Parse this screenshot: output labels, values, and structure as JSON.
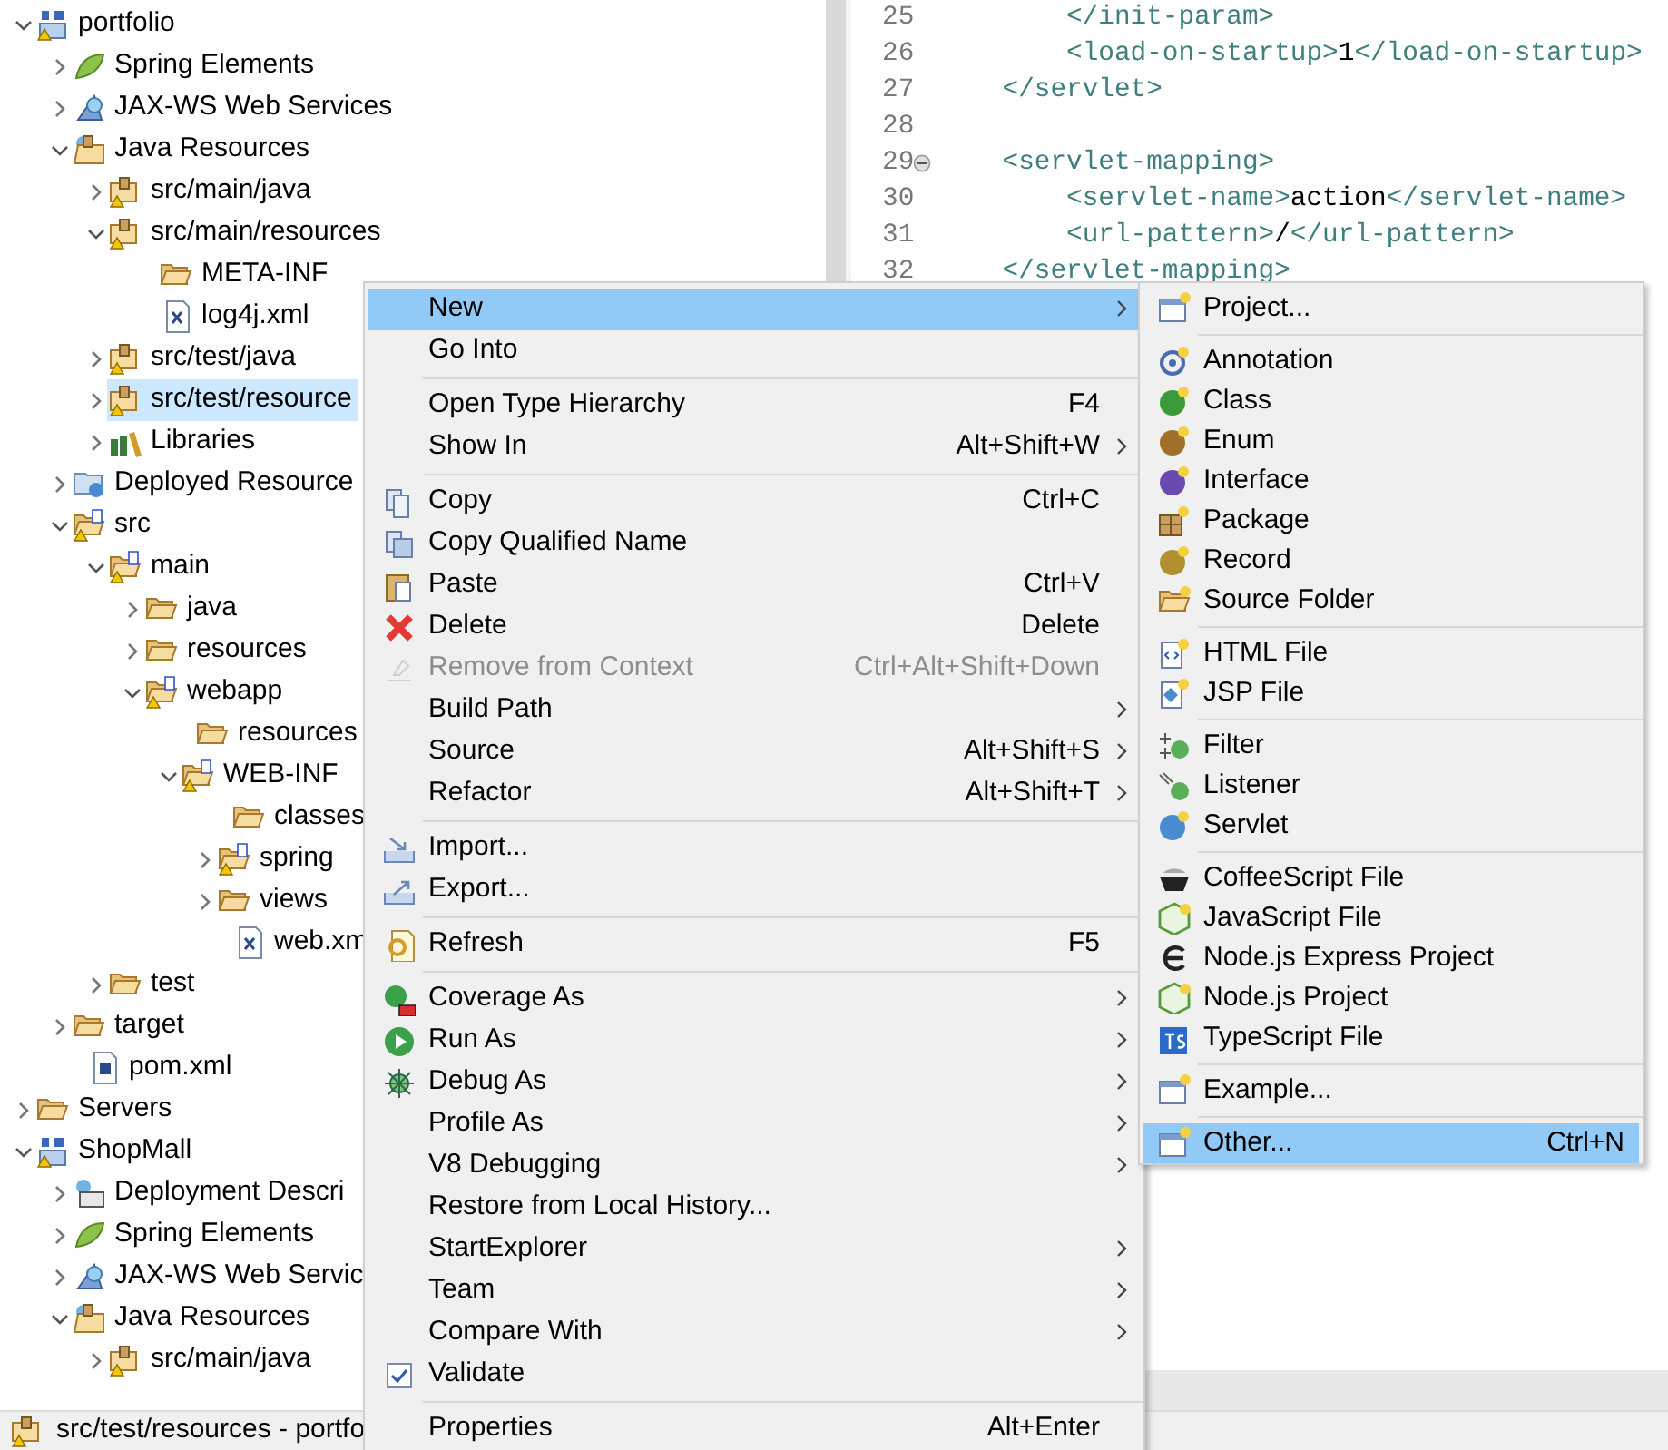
{
  "tree": [
    {
      "label": "portfolio",
      "kind": "project",
      "selected": false,
      "expanded": true,
      "children": [
        {
          "label": "Spring Elements",
          "kind": "spring",
          "selected": false,
          "expanded": false
        },
        {
          "label": "JAX-WS Web Services",
          "kind": "webservice",
          "selected": false,
          "expanded": false
        },
        {
          "label": "Java Resources",
          "kind": "javares",
          "selected": false,
          "expanded": true,
          "children": [
            {
              "label": "src/main/java",
              "kind": "package",
              "selected": false,
              "expanded": false
            },
            {
              "label": "src/main/resources",
              "kind": "package",
              "selected": false,
              "expanded": true,
              "children": [
                {
                  "label": "META-INF",
                  "kind": "folder",
                  "selected": false
                },
                {
                  "label": "log4j.xml",
                  "kind": "xml",
                  "selected": false
                }
              ]
            },
            {
              "label": "src/test/java",
              "kind": "package",
              "selected": false,
              "expanded": false
            },
            {
              "label": "src/test/resource",
              "kind": "package",
              "selected": true,
              "expanded": false
            },
            {
              "label": "Libraries",
              "kind": "library",
              "selected": false,
              "expanded": false
            }
          ]
        },
        {
          "label": "Deployed Resource",
          "kind": "deployed",
          "selected": false,
          "expanded": false
        },
        {
          "label": "src",
          "kind": "srcfolder",
          "selected": false,
          "expanded": true,
          "children": [
            {
              "label": "main",
              "kind": "srcfolder",
              "selected": false,
              "expanded": true,
              "children": [
                {
                  "label": "java",
                  "kind": "folder",
                  "selected": false,
                  "expanded": false
                },
                {
                  "label": "resources",
                  "kind": "folder",
                  "selected": false,
                  "expanded": false
                },
                {
                  "label": "webapp",
                  "kind": "srcfolder",
                  "selected": false,
                  "expanded": true,
                  "children": [
                    {
                      "label": "resources",
                      "kind": "folder",
                      "selected": false
                    },
                    {
                      "label": "WEB-INF",
                      "kind": "srcfolder",
                      "selected": false,
                      "expanded": true,
                      "children": [
                        {
                          "label": "classes",
                          "kind": "folder",
                          "selected": false
                        },
                        {
                          "label": "spring",
                          "kind": "srcfolder",
                          "selected": false,
                          "expanded": false
                        },
                        {
                          "label": "views",
                          "kind": "folder",
                          "selected": false,
                          "expanded": false
                        },
                        {
                          "label": "web.xm",
                          "kind": "xml",
                          "selected": false
                        }
                      ]
                    }
                  ]
                }
              ]
            },
            {
              "label": "test",
              "kind": "folder",
              "selected": false,
              "expanded": false
            }
          ]
        },
        {
          "label": "target",
          "kind": "folder",
          "selected": false,
          "expanded": false
        },
        {
          "label": "pom.xml",
          "kind": "pom",
          "selected": false
        }
      ]
    },
    {
      "label": "Servers",
      "kind": "folder",
      "selected": false,
      "expanded": false
    },
    {
      "label": "ShopMall",
      "kind": "project",
      "selected": false,
      "expanded": true,
      "children": [
        {
          "label": "Deployment Descri",
          "kind": "descriptor",
          "selected": false,
          "expanded": false
        },
        {
          "label": "Spring Elements",
          "kind": "spring",
          "selected": false,
          "expanded": false
        },
        {
          "label": "JAX-WS Web Servic",
          "kind": "webservice",
          "selected": false,
          "expanded": false
        },
        {
          "label": "Java Resources",
          "kind": "javares",
          "selected": false,
          "expanded": true,
          "children": [
            {
              "label": "src/main/java",
              "kind": "package",
              "selected": false,
              "expanded": false
            }
          ]
        }
      ]
    }
  ],
  "editor": {
    "lines": [
      {
        "number": "25",
        "segments": [
          {
            "text": "        </init-param>",
            "kind": "tag"
          }
        ]
      },
      {
        "number": "26",
        "segments": [
          {
            "text": "        <load-on-startup>",
            "kind": "tag"
          },
          {
            "text": "1",
            "kind": "text"
          },
          {
            "text": "</load-on-startup>",
            "kind": "tag"
          }
        ]
      },
      {
        "number": "27",
        "segments": [
          {
            "text": "    </servlet>",
            "kind": "tag"
          }
        ]
      },
      {
        "number": "28"
      },
      {
        "number": "29",
        "folded": true,
        "segments": [
          {
            "text": "    <servlet-mapping>",
            "kind": "tag"
          }
        ]
      },
      {
        "number": "30",
        "segments": [
          {
            "text": "        <servlet-name>",
            "kind": "tag"
          },
          {
            "text": "action",
            "kind": "text"
          },
          {
            "text": "</servlet-name>",
            "kind": "tag"
          }
        ]
      },
      {
        "number": "31",
        "segments": [
          {
            "text": "        <url-pattern>",
            "kind": "tag"
          },
          {
            "text": "/",
            "kind": "text"
          },
          {
            "text": "</url-pattern>",
            "kind": "tag"
          }
        ]
      },
      {
        "number": "32",
        "segments": [
          {
            "text": "    </servlet-mapping>",
            "kind": "tag"
          }
        ]
      }
    ]
  },
  "status_bar": {
    "text": "src/test/resources - portfo"
  },
  "menu": {
    "groups": [
      {
        "items": [
          {
            "label": "New",
            "kind": "none",
            "selected": true,
            "disabled": false,
            "submenu": true
          },
          {
            "label": "Go Into",
            "kind": "none",
            "selected": false,
            "disabled": false,
            "submenu": false
          }
        ]
      },
      {
        "items": [
          {
            "label": "Open Type Hierarchy",
            "kind": "none",
            "shortcut": "F4",
            "selected": false,
            "disabled": false,
            "submenu": false
          },
          {
            "label": "Show In",
            "kind": "none",
            "shortcut": "Alt+Shift+W",
            "selected": false,
            "disabled": false,
            "submenu": true
          }
        ]
      },
      {
        "items": [
          {
            "label": "Copy",
            "kind": "copy",
            "shortcut": "Ctrl+C",
            "selected": false,
            "disabled": false,
            "submenu": false
          },
          {
            "label": "Copy Qualified Name",
            "kind": "copyname",
            "selected": false,
            "disabled": false,
            "submenu": false
          },
          {
            "label": "Paste",
            "kind": "paste",
            "shortcut": "Ctrl+V",
            "selected": false,
            "disabled": false,
            "submenu": false
          },
          {
            "label": "Delete",
            "kind": "delete",
            "shortcut": "Delete",
            "selected": false,
            "disabled": false,
            "submenu": false
          },
          {
            "label": "Remove from Context",
            "kind": "remove",
            "shortcut": "Ctrl+Alt+Shift+Down",
            "selected": false,
            "disabled": true,
            "submenu": false
          },
          {
            "label": "Build Path",
            "kind": "none",
            "selected": false,
            "disabled": false,
            "submenu": true
          },
          {
            "label": "Source",
            "kind": "none",
            "shortcut": "Alt+Shift+S",
            "selected": false,
            "disabled": false,
            "submenu": true
          },
          {
            "label": "Refactor",
            "kind": "none",
            "shortcut": "Alt+Shift+T",
            "selected": false,
            "disabled": false,
            "submenu": true
          }
        ]
      },
      {
        "items": [
          {
            "label": "Import...",
            "kind": "import",
            "selected": false,
            "disabled": false,
            "submenu": false
          },
          {
            "label": "Export...",
            "kind": "export",
            "selected": false,
            "disabled": false,
            "submenu": false
          }
        ]
      },
      {
        "items": [
          {
            "label": "Refresh",
            "kind": "refresh",
            "shortcut": "F5",
            "selected": false,
            "disabled": false,
            "submenu": false
          }
        ]
      },
      {
        "items": [
          {
            "label": "Coverage As",
            "kind": "coverage",
            "selected": false,
            "disabled": false,
            "submenu": true
          },
          {
            "label": "Run As",
            "kind": "run",
            "selected": false,
            "disabled": false,
            "submenu": true
          },
          {
            "label": "Debug As",
            "kind": "debug",
            "selected": false,
            "disabled": false,
            "submenu": true
          },
          {
            "label": "Profile As",
            "kind": "none",
            "selected": false,
            "disabled": false,
            "submenu": true
          },
          {
            "label": "V8 Debugging",
            "kind": "none",
            "selected": false,
            "disabled": false,
            "submenu": true
          },
          {
            "label": "Restore from Local History...",
            "kind": "none",
            "selected": false,
            "disabled": false,
            "submenu": false
          },
          {
            "label": "StartExplorer",
            "kind": "none",
            "selected": false,
            "disabled": false,
            "submenu": true
          },
          {
            "label": "Team",
            "kind": "none",
            "selected": false,
            "disabled": false,
            "submenu": true
          },
          {
            "label": "Compare With",
            "kind": "none",
            "selected": false,
            "disabled": false,
            "submenu": true
          },
          {
            "label": "Validate",
            "kind": "none",
            "checked": true,
            "selected": false,
            "disabled": false,
            "submenu": false
          }
        ]
      },
      {
        "items": [
          {
            "label": "Properties",
            "kind": "none",
            "shortcut": "Alt+Enter",
            "selected": false,
            "disabled": false,
            "submenu": false
          }
        ]
      }
    ]
  },
  "submenu": {
    "groups": [
      {
        "items": [
          {
            "label": "Project...",
            "kind": "wizard",
            "selected": false
          }
        ]
      },
      {
        "items": [
          {
            "label": "Annotation",
            "kind": "annotation",
            "selected": false
          },
          {
            "label": "Class",
            "kind": "class",
            "selected": false
          },
          {
            "label": "Enum",
            "kind": "enum",
            "selected": false
          },
          {
            "label": "Interface",
            "kind": "interface",
            "selected": false
          },
          {
            "label": "Package",
            "kind": "packagenew",
            "selected": false
          },
          {
            "label": "Record",
            "kind": "record",
            "selected": false
          },
          {
            "label": "Source Folder",
            "kind": "sourcefolder",
            "selected": false
          }
        ]
      },
      {
        "items": [
          {
            "label": "HTML File",
            "kind": "html",
            "selected": false
          },
          {
            "label": "JSP File",
            "kind": "jsp",
            "selected": false
          }
        ]
      },
      {
        "items": [
          {
            "label": "Filter",
            "kind": "filter",
            "selected": false
          },
          {
            "label": "Listener",
            "kind": "listener",
            "selected": false
          },
          {
            "label": "Servlet",
            "kind": "servlet",
            "selected": false
          }
        ]
      },
      {
        "items": [
          {
            "label": "CoffeeScript File",
            "kind": "coffee",
            "selected": false
          },
          {
            "label": "JavaScript File",
            "kind": "js",
            "selected": false
          },
          {
            "label": "Node.js Express Project",
            "kind": "express",
            "selected": false
          },
          {
            "label": "Node.js Project",
            "kind": "js",
            "selected": false
          },
          {
            "label": "TypeScript File",
            "kind": "ts",
            "selected": false
          }
        ]
      },
      {
        "items": [
          {
            "label": "Example...",
            "kind": "wizard",
            "selected": false
          }
        ]
      },
      {
        "items": [
          {
            "label": "Other...",
            "kind": "wizard",
            "shortcut": "Ctrl+N",
            "selected": true
          }
        ]
      }
    ]
  }
}
